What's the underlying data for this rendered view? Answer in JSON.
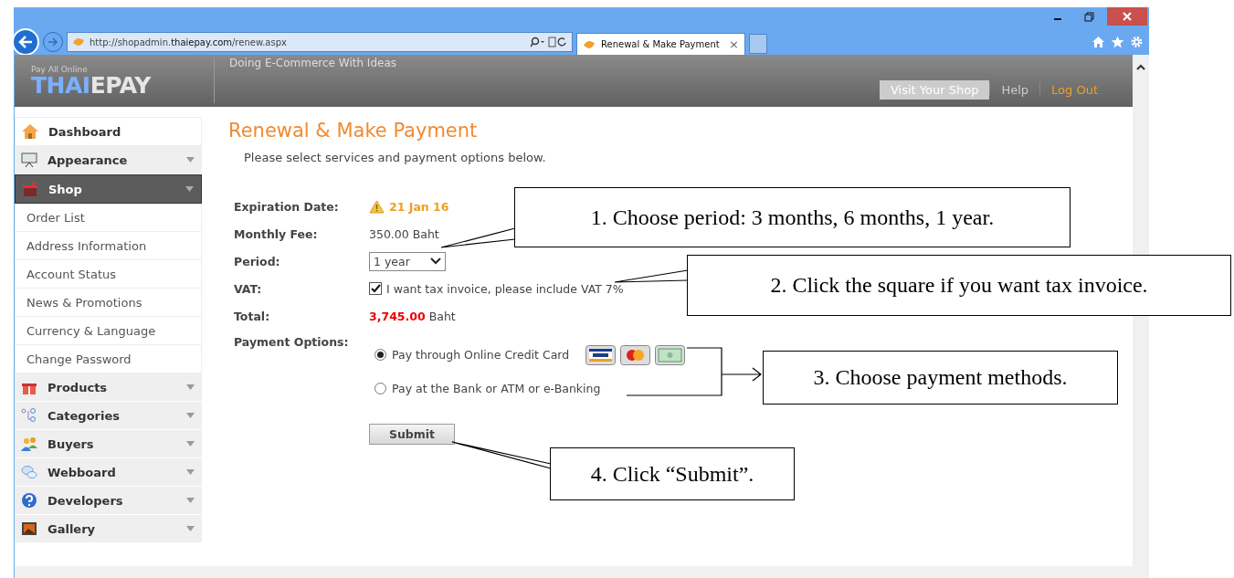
{
  "browser": {
    "address": "http://shopadmin.**thaiepay.com**/renew.aspx",
    "tab": {
      "title": "Renewal & Make Payment",
      "close": "×"
    }
  },
  "header": {
    "tagline": "Pay All Online",
    "logo": {
      "accent": "THAI",
      "rest": "EPAY"
    },
    "slogan": "Doing E-Commerce With Ideas",
    "nav": [
      {
        "label": "Visit Your Shop",
        "kind": "button"
      },
      {
        "label": "Help",
        "kind": "link"
      },
      {
        "label": "Log Out",
        "kind": "accent"
      }
    ]
  },
  "sidebar": {
    "items": [
      {
        "label": "Dashboard",
        "kind": "section",
        "selected": false,
        "expandable": false
      },
      {
        "label": "Appearance",
        "kind": "section",
        "selected": false,
        "expandable": true
      },
      {
        "label": "Shop",
        "kind": "section",
        "selected": true,
        "expandable": true,
        "children": [
          {
            "label": "Order List"
          },
          {
            "label": "Address Information"
          },
          {
            "label": "Account Status"
          },
          {
            "label": "News & Promotions"
          },
          {
            "label": "Currency & Language"
          },
          {
            "label": "Change Password"
          }
        ]
      },
      {
        "label": "Products",
        "kind": "section",
        "selected": false,
        "expandable": true
      },
      {
        "label": "Categories",
        "kind": "section",
        "selected": false,
        "expandable": true
      },
      {
        "label": "Buyers",
        "kind": "section",
        "selected": false,
        "expandable": true
      },
      {
        "label": "Webboard",
        "kind": "section",
        "selected": false,
        "expandable": true
      },
      {
        "label": "Developers",
        "kind": "section",
        "selected": false,
        "expandable": true
      },
      {
        "label": "Gallery",
        "kind": "section",
        "selected": false,
        "expandable": true
      }
    ]
  },
  "page": {
    "title": "Renewal & Make Payment",
    "intro": "Please select services and payment options below.",
    "rows": [
      {
        "label": "Expiration Date:",
        "kind": "warning",
        "value": "21 Jan 16"
      },
      {
        "label": "Monthly Fee:",
        "kind": "text",
        "value": "350.00 Baht"
      },
      {
        "label": "Period:",
        "kind": "select",
        "value": "1 year"
      },
      {
        "label": "VAT:",
        "kind": "checkbox",
        "checked": true,
        "value": "I want tax invoice, please include VAT 7%"
      },
      {
        "label": "Total:",
        "kind": "total",
        "value": "3,745.00",
        "unit": "Baht"
      },
      {
        "label": "Payment Options:",
        "kind": "radio",
        "options": [
          {
            "label": "Pay through Online Credit Card",
            "selected": true,
            "cards": true
          },
          {
            "label": "Pay at the Bank or ATM or e-Banking",
            "selected": false,
            "cards": false
          }
        ]
      }
    ],
    "submit": "Submit"
  },
  "callouts": [
    "1. Choose period: 3 months, 6 months, 1 year.",
    "2. Click the square if you want tax invoice.",
    "3. Choose payment methods.",
    "4. Click “Submit”."
  ]
}
